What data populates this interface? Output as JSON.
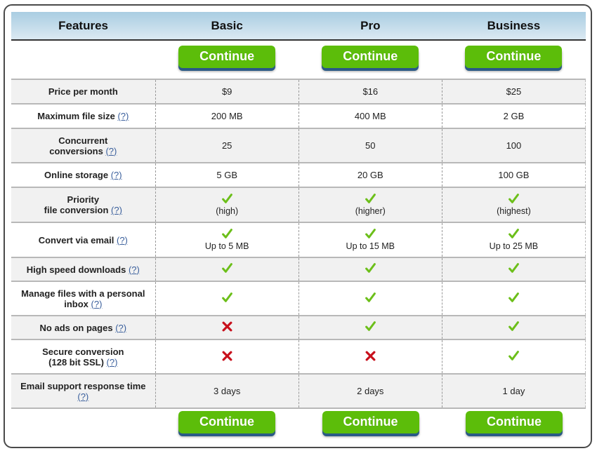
{
  "header": {
    "features": "Features",
    "plans": [
      "Basic",
      "Pro",
      "Business"
    ]
  },
  "buttons": {
    "continue_label": "Continue"
  },
  "help_label": "(?)",
  "colors": {
    "button_green": "#5cbd0a",
    "button_shadow": "#2a5a86",
    "check_green": "#6cbf1a",
    "cross_red": "#c8101c",
    "header_gradient_top": "#a9cde2"
  },
  "rows": [
    {
      "feature": "Price per month",
      "help": false,
      "cells": [
        {
          "text": "$9"
        },
        {
          "text": "$16"
        },
        {
          "text": "$25"
        }
      ]
    },
    {
      "feature": "Maximum file size",
      "help": true,
      "cells": [
        {
          "text": "200 MB"
        },
        {
          "text": "400 MB"
        },
        {
          "text": "2 GB"
        }
      ]
    },
    {
      "feature_lines": [
        "Concurrent",
        "conversions"
      ],
      "help": true,
      "cells": [
        {
          "text": "25"
        },
        {
          "text": "50"
        },
        {
          "text": "100"
        }
      ]
    },
    {
      "feature": "Online storage",
      "help": true,
      "cells": [
        {
          "text": "5 GB"
        },
        {
          "text": "20 GB"
        },
        {
          "text": "100 GB"
        }
      ]
    },
    {
      "feature_lines": [
        "Priority",
        "file conversion"
      ],
      "help": true,
      "cells": [
        {
          "icon": "check-icon",
          "text": "(high)"
        },
        {
          "icon": "check-icon",
          "text": "(higher)"
        },
        {
          "icon": "check-icon",
          "text": "(highest)"
        }
      ]
    },
    {
      "feature": "Convert via email",
      "help": true,
      "cells": [
        {
          "icon": "check-icon",
          "text": "Up to 5 MB"
        },
        {
          "icon": "check-icon",
          "text": "Up to 15 MB"
        },
        {
          "icon": "check-icon",
          "text": "Up to 25 MB"
        }
      ]
    },
    {
      "feature": "High speed downloads",
      "help": true,
      "cells": [
        {
          "icon": "check-icon"
        },
        {
          "icon": "check-icon"
        },
        {
          "icon": "check-icon"
        }
      ]
    },
    {
      "feature_lines": [
        "Manage files with a personal",
        "inbox"
      ],
      "help": true,
      "cells": [
        {
          "icon": "check-icon"
        },
        {
          "icon": "check-icon"
        },
        {
          "icon": "check-icon"
        }
      ]
    },
    {
      "feature": "No ads on pages",
      "help": true,
      "cells": [
        {
          "icon": "cross-icon"
        },
        {
          "icon": "check-icon"
        },
        {
          "icon": "check-icon"
        }
      ]
    },
    {
      "feature_lines": [
        "Secure conversion",
        "(128 bit SSL)"
      ],
      "help": true,
      "cells": [
        {
          "icon": "cross-icon"
        },
        {
          "icon": "cross-icon"
        },
        {
          "icon": "check-icon"
        }
      ]
    },
    {
      "feature_lines": [
        "Email support response time",
        ""
      ],
      "help": true,
      "cells": [
        {
          "text": "3 days"
        },
        {
          "text": "2 days"
        },
        {
          "text": "1 day"
        }
      ]
    }
  ]
}
